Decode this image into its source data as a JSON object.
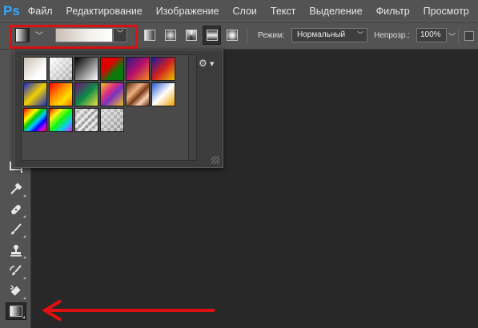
{
  "app": {
    "logo": "Ps"
  },
  "menu": [
    "Файл",
    "Редактирование",
    "Изображение",
    "Слои",
    "Текст",
    "Выделение",
    "Фильтр",
    "Просмотр"
  ],
  "options": {
    "mode_label": "Режим:",
    "mode_value": "Нормальный",
    "opacity_label": "Непрозр.:",
    "opacity_value": "100%",
    "gradient_types": [
      "linear",
      "radial",
      "angle",
      "reflected",
      "diamond"
    ],
    "selected_gradient_type": "reflected"
  },
  "toolbar": {
    "tools": [
      "eyedropper-icon",
      "healing-brush-icon",
      "brush-icon",
      "clone-stamp-icon",
      "history-brush-icon",
      "eraser-icon",
      "gradient-icon"
    ],
    "active_tool": "gradient-icon"
  },
  "gradient_picker": {
    "presets": [
      "foreground-to-background",
      "foreground-to-transparent",
      "black-white",
      "red-green",
      "violet-orange",
      "blue-red-yellow",
      "blue-yellow-blue",
      "orange-yellow-orange",
      "violet-green-orange",
      "yellow-violet-orange-blue",
      "copper",
      "chrome",
      "spectrum",
      "transparent-rainbow",
      "transparent-stripes",
      "neutral-density"
    ]
  },
  "colors": {
    "highlight": "#e01010",
    "panel": "#535353",
    "canvas": "#282828"
  }
}
